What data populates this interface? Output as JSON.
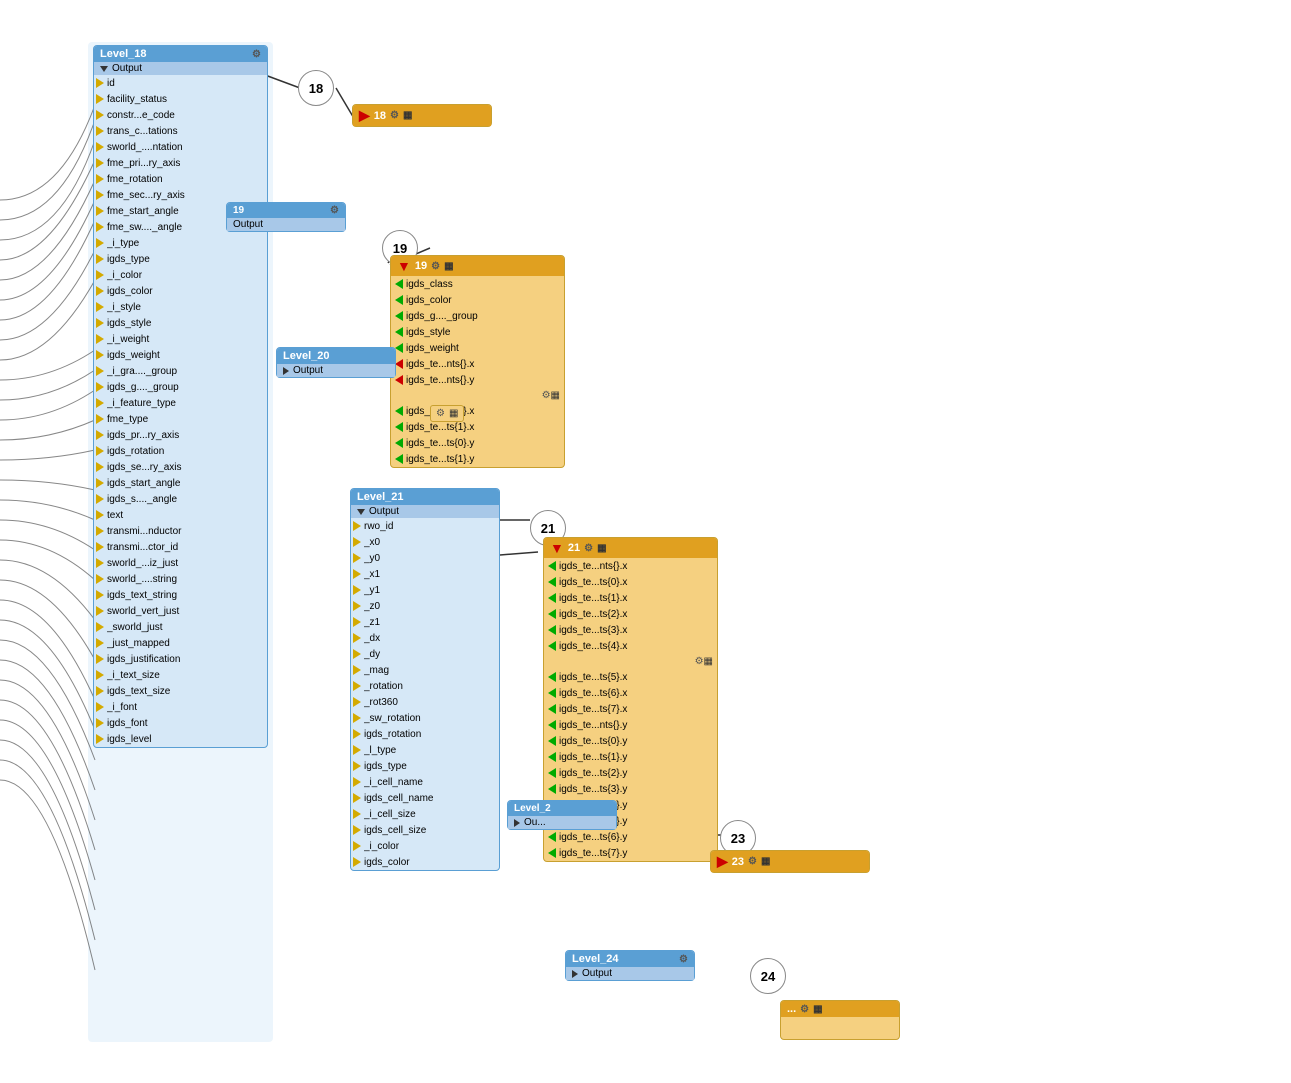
{
  "nodes": {
    "level18": {
      "title": "Level_18",
      "section": "Output",
      "ports": [
        "id",
        "facility_status",
        "constr...e_code",
        "trans_c...tations",
        "sworld_....ntation",
        "fme_pri...ry_axis",
        "fme_rotation",
        "fme_sec...ry_axis",
        "fme_start_angle",
        "fme_sw...._angle",
        "_i_type",
        "igds_type",
        "_i_color",
        "igds_color",
        "_i_style",
        "igds_style",
        "_i_weight",
        "igds_weight",
        "_i_gra...._group",
        "igds_g...._group",
        "_i_feature_type",
        "fme_type",
        "igds_pr...ry_axis",
        "igds_rotation",
        "igds_se...ry_axis",
        "igds_start_angle",
        "igds_s...._angle",
        "text",
        "transmi...nductor",
        "transmi...ctor_id",
        "sworld_...iz_just",
        "sworld_....string",
        "igds_text_string",
        "sworld_vert_just",
        "_sworld_just",
        "_just_mapped",
        "igds_justification",
        "_i_text_size",
        "igds_text_size",
        "_i_font",
        "igds_font",
        "igds_level"
      ]
    },
    "level19": {
      "title": "19",
      "section": "Output",
      "ports_out": [
        "igds_class",
        "igds_color",
        "igds_g...._group",
        "igds_style",
        "igds_weight",
        "igds_te...nts{}.x",
        "igds_te...nts{}.y",
        "igds_te...ts{0}.x",
        "igds_te...ts{1}.x",
        "igds_te...ts{0}.y",
        "igds_te...ts{1}.y"
      ]
    },
    "level20": {
      "title": "Level_20",
      "section": "Output",
      "ports": []
    },
    "level21": {
      "title": "Level_21",
      "section": "Output",
      "ports": [
        "rwo_id",
        "_x0",
        "_y0",
        "_x1",
        "_y1",
        "_z0",
        "_z1",
        "_dx",
        "_dy",
        "_mag",
        "_rotation",
        "_rot360",
        "_sw_rotation",
        "igds_rotation",
        "_l_type",
        "igds_type",
        "_i_cell_name",
        "igds_cell_name",
        "_i_cell_size",
        "igds_cell_size",
        "_i_color",
        "igds_color"
      ]
    },
    "level22": {
      "title": "Level_2",
      "section": "Output",
      "ports": []
    },
    "level24": {
      "title": "Level_24",
      "section": "Output",
      "ports": []
    }
  },
  "writers": {
    "w18": {
      "label": "18",
      "number": "18"
    },
    "w19": {
      "label": "19",
      "number": "19"
    },
    "w21": {
      "label": "21",
      "number": "21"
    },
    "w23": {
      "label": "23",
      "number": "23"
    }
  },
  "callouts": {
    "c18": {
      "number": "18"
    },
    "c19": {
      "number": "19"
    },
    "c21": {
      "number": "21"
    },
    "c23": {
      "number": "23"
    },
    "c24": {
      "number": "24"
    }
  },
  "icons": {
    "gear": "⚙",
    "table": "▦",
    "triangle_down": "▼",
    "triangle_right": "▷"
  }
}
